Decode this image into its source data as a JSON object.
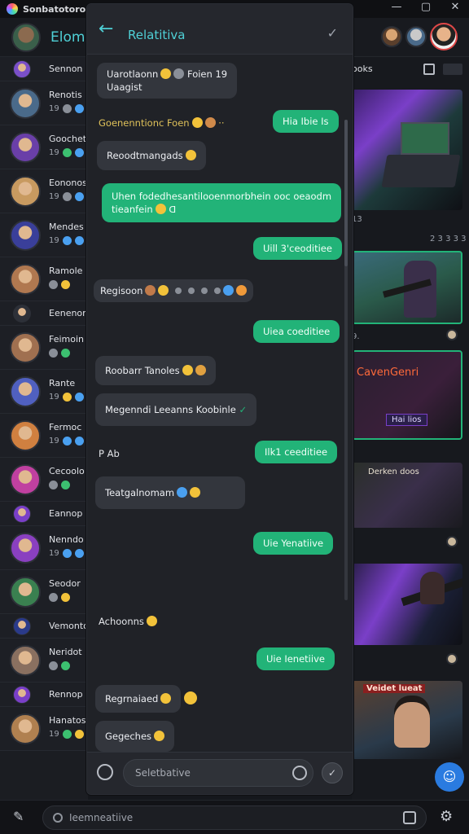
{
  "window": {
    "title": "Sonbatotororn"
  },
  "header": {
    "app_name": "Elomx"
  },
  "contacts": [
    {
      "name": "Sennon S",
      "meta": "",
      "small": true,
      "avatar_color": "#7a4fc8"
    },
    {
      "name": "Renotis",
      "meta": "19",
      "small": false,
      "avatar_color": "#4a6a8a",
      "dots": [
        "#8a8f98",
        "#4aa0f0"
      ]
    },
    {
      "name": "Goochet",
      "meta": "19",
      "small": false,
      "avatar_color": "#6a3fa8",
      "dots": [
        "#3cc070",
        "#4aa0f0"
      ]
    },
    {
      "name": "Eononos",
      "meta": "19",
      "small": false,
      "avatar_color": "#c89a60",
      "dots": [
        "#8a8f98",
        "#4aa0f0"
      ]
    },
    {
      "name": "Mendes",
      "meta": "19",
      "small": false,
      "avatar_color": "#3a3f9a",
      "dots": [
        "#4aa0f0",
        "#4aa0f0"
      ]
    },
    {
      "name": "Ramole",
      "meta": "",
      "small": false,
      "avatar_color": "#b07850",
      "dots": [
        "#8a8f98",
        "#f2c23a"
      ]
    },
    {
      "name": "Eenenon",
      "meta": "",
      "small": true,
      "avatar_color": "#2d3038"
    },
    {
      "name": "Feimoin",
      "meta": "",
      "small": false,
      "avatar_color": "#a07050",
      "dots": [
        "#8a8f98",
        "#3cc070"
      ]
    },
    {
      "name": "Rante",
      "meta": "19",
      "small": false,
      "avatar_color": "#5060c0",
      "dots": [
        "#f2c23a",
        "#4aa0f0"
      ]
    },
    {
      "name": "Fermoc",
      "meta": "19",
      "small": false,
      "avatar_color": "#d08040",
      "dots": [
        "#4aa0f0",
        "#4aa0f0"
      ]
    },
    {
      "name": "Cecoolo",
      "meta": "",
      "small": false,
      "avatar_color": "#c040a0",
      "dots": [
        "#8a8f98",
        "#3cc070"
      ]
    },
    {
      "name": "Eannop",
      "meta": "",
      "small": true,
      "avatar_color": "#7a3fc8"
    },
    {
      "name": "Nenndo",
      "meta": "19",
      "small": false,
      "avatar_color": "#8a40c0",
      "dots": [
        "#4aa0f0",
        "#4aa0f0"
      ]
    },
    {
      "name": "Seodor",
      "meta": "",
      "small": false,
      "avatar_color": "#3a8050",
      "dots": [
        "#8a8f98",
        "#f2c23a"
      ]
    },
    {
      "name": "Vemonto",
      "meta": "",
      "small": true,
      "avatar_color": "#2a3a8a"
    },
    {
      "name": "Neridot",
      "meta": "",
      "small": false,
      "avatar_color": "#8a7060",
      "dots": [
        "#8a8f98",
        "#3cc070"
      ]
    },
    {
      "name": "Rennop",
      "meta": "",
      "small": true,
      "avatar_color": "#7a3fc8"
    },
    {
      "name": "Hanatos",
      "meta": "19",
      "small": false,
      "avatar_color": "#b08050",
      "dots": [
        "#3cc070",
        "#f2c23a"
      ]
    }
  ],
  "chat": {
    "title": "Relatitiva",
    "messages": [
      {
        "dir": "in",
        "lines": [
          "Uarotlaonn",
          "Uaagist"
        ],
        "extra": "Foien 19"
      },
      {
        "dir": "caption",
        "text": "Goenenntionc Foen"
      },
      {
        "dir": "out",
        "text": "Hia Ibie Is"
      },
      {
        "dir": "in",
        "text": "Reoodtmangads"
      },
      {
        "dir": "out",
        "lines": [
          "Uhen fodedhesantilooenmorbhein  ooc oeaodm",
          "tieanfein"
        ]
      },
      {
        "dir": "out",
        "text": "Uill 3'ceoditiee"
      },
      {
        "dir": "plain",
        "text": "Regisoon"
      },
      {
        "dir": "out",
        "text": "Uiea coeditiee"
      },
      {
        "dir": "in",
        "text": "Roobarr Tanoles"
      },
      {
        "dir": "in",
        "text": "Megenndi Leeanns Koobinle"
      },
      {
        "dir": "plain",
        "text": "P  Ab"
      },
      {
        "dir": "out",
        "text": "Ilk1 ceeditiee"
      },
      {
        "dir": "in",
        "text": "Teatgalnomam"
      },
      {
        "dir": "out",
        "text": "Uie Yenatiive"
      },
      {
        "dir": "plain",
        "text": "Achoonns"
      },
      {
        "dir": "out",
        "text": "Uie Ienetiive"
      },
      {
        "dir": "in",
        "text": "Regrnaiaed"
      },
      {
        "dir": "in",
        "text": "Gegeches"
      }
    ],
    "composer_placeholder": "Seletbative"
  },
  "gallery": {
    "top_label": "ooks",
    "tiles": [
      {
        "caption": "13",
        "meta": "2 3 3 3 3"
      },
      {
        "caption": "9."
      },
      {
        "label": "CavenGenri",
        "badge": "Hai lios"
      },
      {
        "label": "Derken doos"
      },
      {
        "label": ""
      },
      {
        "label": "Veidet lueat"
      }
    ]
  },
  "search": {
    "placeholder": "Ieemneatiive"
  },
  "colors": {
    "accent_teal": "#4fd0d6",
    "bubble_out": "#22b378",
    "bubble_in": "#33363d",
    "fab_blue": "#2a7be0"
  }
}
